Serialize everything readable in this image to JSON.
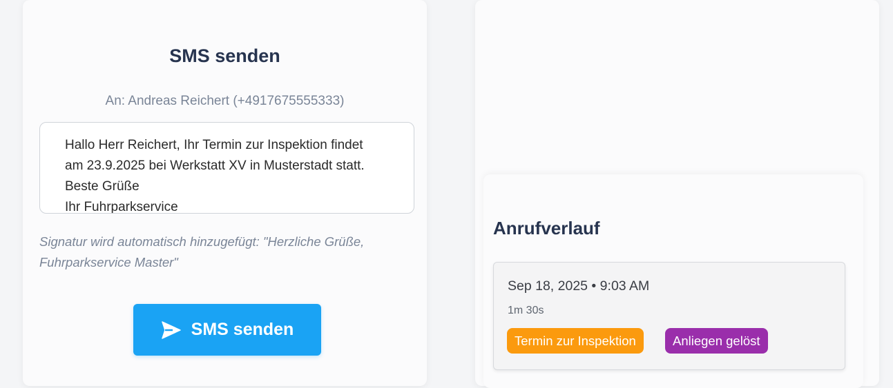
{
  "sms_panel": {
    "title": "SMS senden",
    "recipient": "An: Andreas Reichert (+4917675555333)",
    "message_lines": [
      "Hallo Herr Reichert, Ihr Termin zur Inspektion findet",
      "am 23.9.2025 bei Werkstatt XV in Musterstadt statt.",
      "Beste Grüße",
      "Ihr Fuhrparkservice"
    ],
    "signature_note_lines": [
      "Signatur wird automatisch hinzugefügt: \"Herzliche Grüße,",
      "Fuhrparkservice Master\""
    ],
    "send_button_label": "SMS senden",
    "send_icon": "send-icon",
    "button_color": "#1aa3f4"
  },
  "call_history": {
    "title": "Anrufverlauf",
    "entries": [
      {
        "datetime": "Sep 18, 2025 • 9:03 AM",
        "duration": "1m 30s",
        "tags": [
          {
            "label": "Termin zur Inspektion",
            "color": "#fb9a0e"
          },
          {
            "label": "Anliegen gelöst",
            "color": "#9a2eab"
          }
        ]
      }
    ]
  }
}
